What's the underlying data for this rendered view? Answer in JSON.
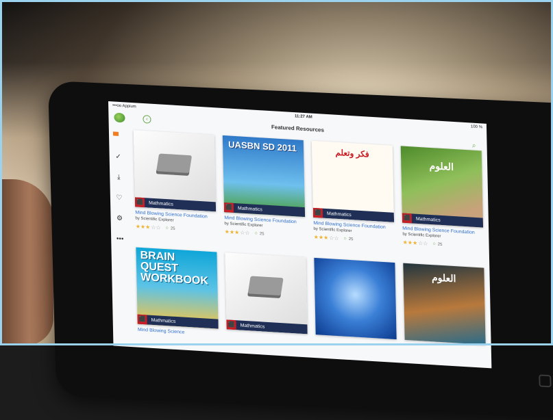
{
  "status": {
    "carrier": "•••oo Appium",
    "time": "11:27 AM",
    "battery": "100 %"
  },
  "header": {
    "title": "Featured Resources"
  },
  "sidebar": {
    "more": "•••"
  },
  "cards": [
    {
      "tag": "Mathmatics",
      "title": "Mind Blowing Science Foundation",
      "author": "by Scientific Explorer",
      "stars": 3,
      "comments": "25"
    },
    {
      "tag": "Mathmatics",
      "title": "Mind Blowing Science Foundation",
      "author": "by Scientific Explorer",
      "stars": 3,
      "comments": "25",
      "cover_text": "UASBN SD 2011"
    },
    {
      "tag": "Mathmatics",
      "title": "Mind Blowing Science Foundation",
      "author": "by Scientific Explorer",
      "stars": 3,
      "comments": "25",
      "cover_text": "فكر وتعلم"
    },
    {
      "tag": "Mathmatics",
      "title": "Mind Blowing Science Foundation",
      "author": "by Scientific Explorer",
      "stars": 3,
      "comments": "25",
      "cover_text": "العلوم"
    },
    {
      "tag": "Mathmatics",
      "title": "Mind Blowing Science",
      "cover_text": "BRAIN QUEST WORKBOOK"
    },
    {
      "tag": "Mathmatics"
    },
    {},
    {
      "cover_text": "العلوم"
    }
  ],
  "colors": {
    "accent": "#6aa84f",
    "tag_bar": "#1f2f55",
    "pdf_red": "#c81d24",
    "link_blue": "#2f6fd0",
    "star": "#f2b233"
  }
}
